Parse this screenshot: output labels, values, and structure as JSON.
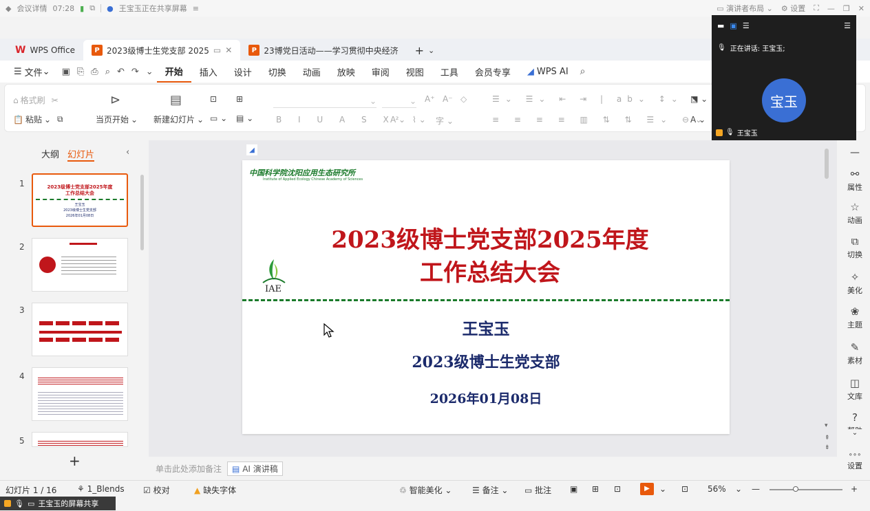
{
  "meeting": {
    "details": "会议详情",
    "timer": "07:28",
    "sharing": "王宝玉正在共享屏幕",
    "layout": "演讲者布局",
    "settings": "设置"
  },
  "tabs": [
    {
      "label": "WPS Office"
    },
    {
      "label": "2023级博士生党支部 2025"
    },
    {
      "label": "23博党日活动——学习贯彻中央经济"
    }
  ],
  "menu": {
    "file": "文件",
    "items": [
      "开始",
      "插入",
      "设计",
      "切换",
      "动画",
      "放映",
      "审阅",
      "视图",
      "工具",
      "会员专享"
    ],
    "wps_ai": "WPS AI"
  },
  "ribbon": {
    "format_painter": "格式刷",
    "paste": "粘贴",
    "play_from_current": "当页开始",
    "new_slide": "新建幻灯片"
  },
  "left_panel": {
    "outline": "大纲",
    "slides": "幻灯片",
    "thumb_numbers": [
      "1",
      "2",
      "3",
      "4",
      "5"
    ],
    "thumb1": {
      "title": "2023级博士党支部2025年度",
      "title2": "工作总结大会",
      "name": "王宝玉",
      "org": "2023级博士生党支部",
      "date": "2026年01月08日"
    }
  },
  "slide": {
    "logo_text": "中国科学院沈阳应用生态研究所",
    "logo_en": "Institute of Applied Ecology Chinese Academy of Sciences",
    "iae": "IAE",
    "title_line1": "2023级博士党支部2025年度",
    "title_line2": "工作总结大会",
    "presenter": "王宝玉",
    "organization": "2023级博士生党支部",
    "date": "2026年01月08日"
  },
  "notes": {
    "placeholder": "单击此处添加备注",
    "ai_notes": "AI 演讲稿"
  },
  "right_sidebar": [
    "属性",
    "动画",
    "切换",
    "美化",
    "主题",
    "素材",
    "文库",
    "帮助",
    "设置"
  ],
  "status": {
    "slide_count": "幻灯片 1 / 16",
    "theme": "1_Blends",
    "proofread": "校对",
    "missing_font": "缺失字体",
    "smart_beautify": "智能美化",
    "notes": "备注",
    "comments": "批注",
    "zoom": "56%"
  },
  "share": {
    "label": "王宝玉的屏幕共享"
  },
  "video": {
    "speaking": "正在讲话: 王宝玉;",
    "avatar_text": "宝玉",
    "name": "王宝玉"
  }
}
